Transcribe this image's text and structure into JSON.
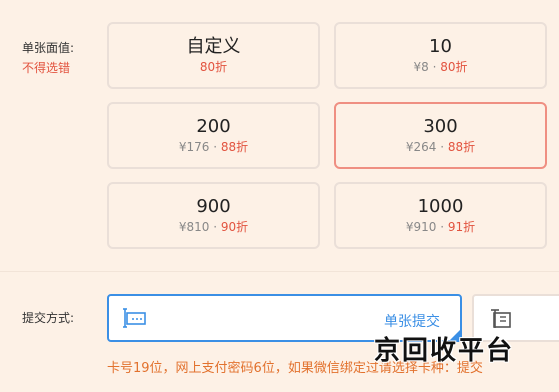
{
  "face_value": {
    "label": "单张面值:",
    "warning": "不得选错"
  },
  "cards": [
    {
      "title": "自定义",
      "price": "",
      "discount": "80折",
      "selected": false
    },
    {
      "title": "10",
      "price": "¥8",
      "discount": "80折",
      "selected": false
    },
    {
      "title": "200",
      "price": "¥176",
      "discount": "88折",
      "selected": false
    },
    {
      "title": "300",
      "price": "¥264",
      "discount": "88折",
      "selected": true
    },
    {
      "title": "900",
      "price": "¥810",
      "discount": "90折",
      "selected": false
    },
    {
      "title": "1000",
      "price": "¥910",
      "discount": "91折",
      "selected": false
    }
  ],
  "separator": " · ",
  "submit_method": {
    "label": "提交方式:",
    "options": [
      {
        "label": "单张提交",
        "icon": "single-card-icon",
        "selected": true
      },
      {
        "label": "",
        "icon": "batch-card-icon",
        "selected": false
      }
    ]
  },
  "note": "卡号19位，网上支付密码6位，如果微信绑定过请选择卡种：提交",
  "watermark": "京回收平台",
  "colors": {
    "accent_blue": "#3b8fe5",
    "discount_red": "#e2533f",
    "selected_border": "#ef8f82",
    "note_orange": "#e2712d",
    "background": "#fdf1e6"
  }
}
